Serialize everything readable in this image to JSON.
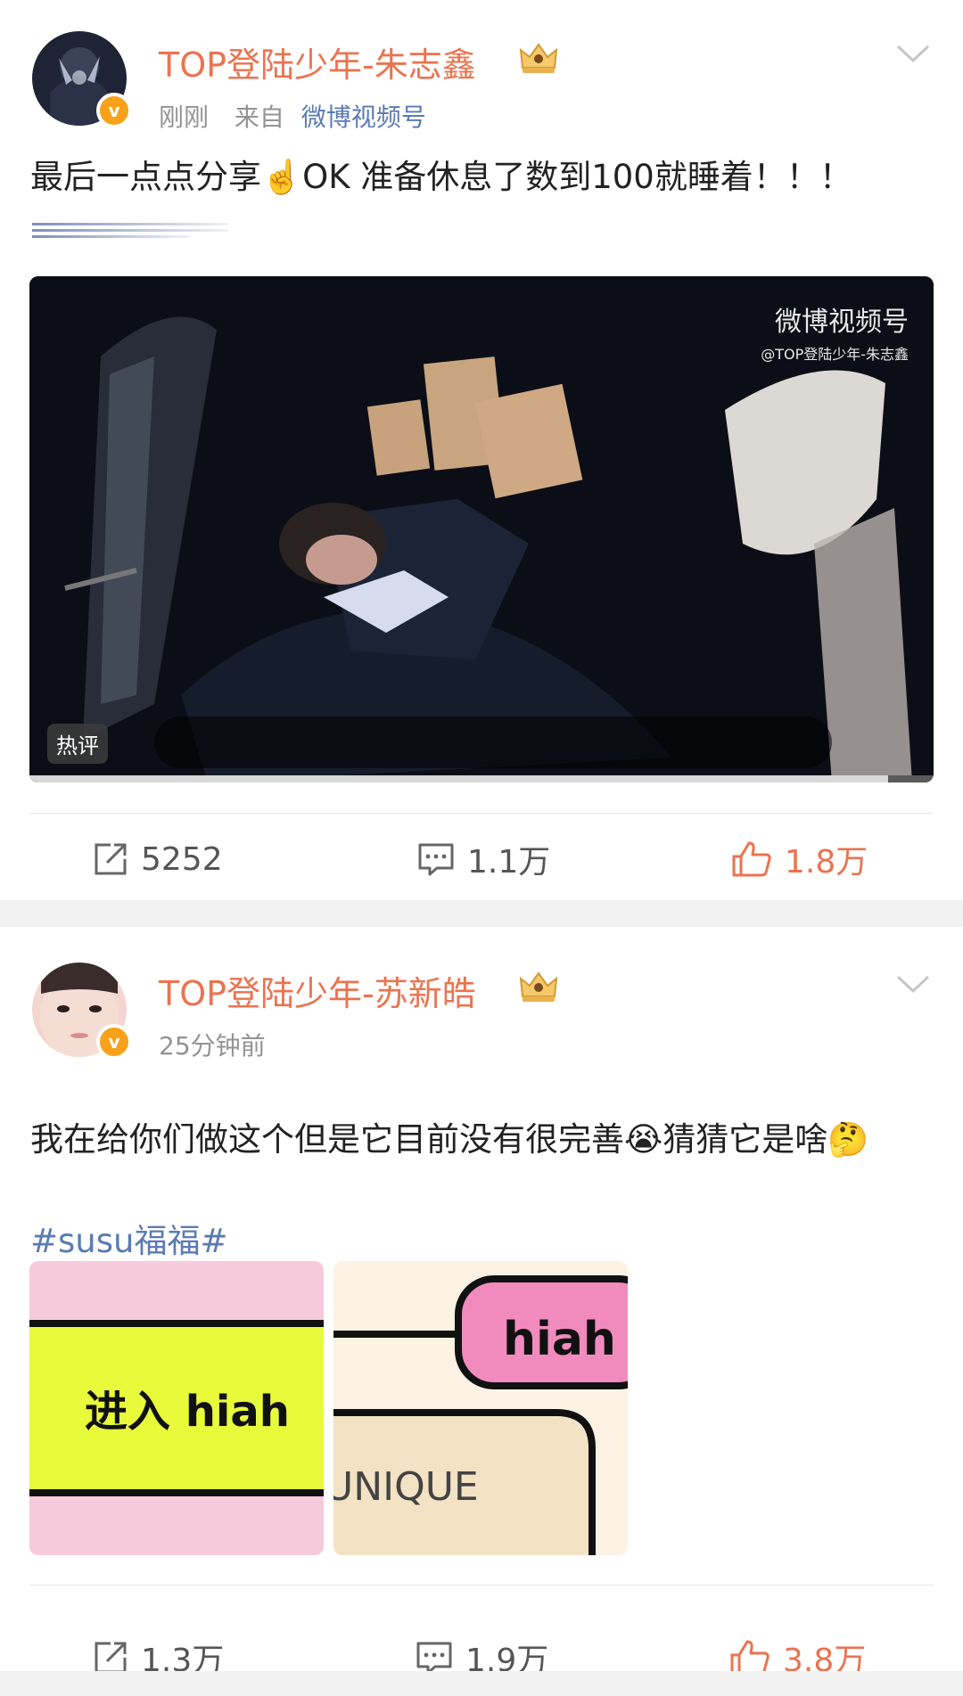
{
  "post1": {
    "username": "TOP登陆少年-朱志鑫",
    "time": "刚刚",
    "from_label": "来自",
    "source": "微博视频号",
    "text": "最后一点点分享☝️OK 准备休息了数到100就睡着！！！",
    "video": {
      "watermark": "微博视频号",
      "watermark_handle": "@TOP登陆少年-朱志鑫",
      "hot_tag": "热评",
      "progress": 0.95
    },
    "actions": {
      "share": "5252",
      "comment": "1.1万",
      "like": "1.8万"
    }
  },
  "post2": {
    "username": "TOP登陆少年-苏新皓",
    "time": "25分钟前",
    "text": "我在给你们做这个但是它目前没有很完善😭猜猜它是啥🤔",
    "hashtag": "#susu福福#",
    "image1_text": "进入 hiah",
    "image2_top": "hiah",
    "image2_bottom": "UNIQUE",
    "actions": {
      "share": "1.3万",
      "comment": "1.9万",
      "like": "3.8万"
    }
  },
  "colors": {
    "accent": "#eb7350",
    "link": "#5a7bb3",
    "muted": "#939393"
  },
  "icons": [
    "verified-badge-icon",
    "crown-icon",
    "chevron-down-icon",
    "share-icon",
    "comment-icon",
    "like-icon"
  ]
}
